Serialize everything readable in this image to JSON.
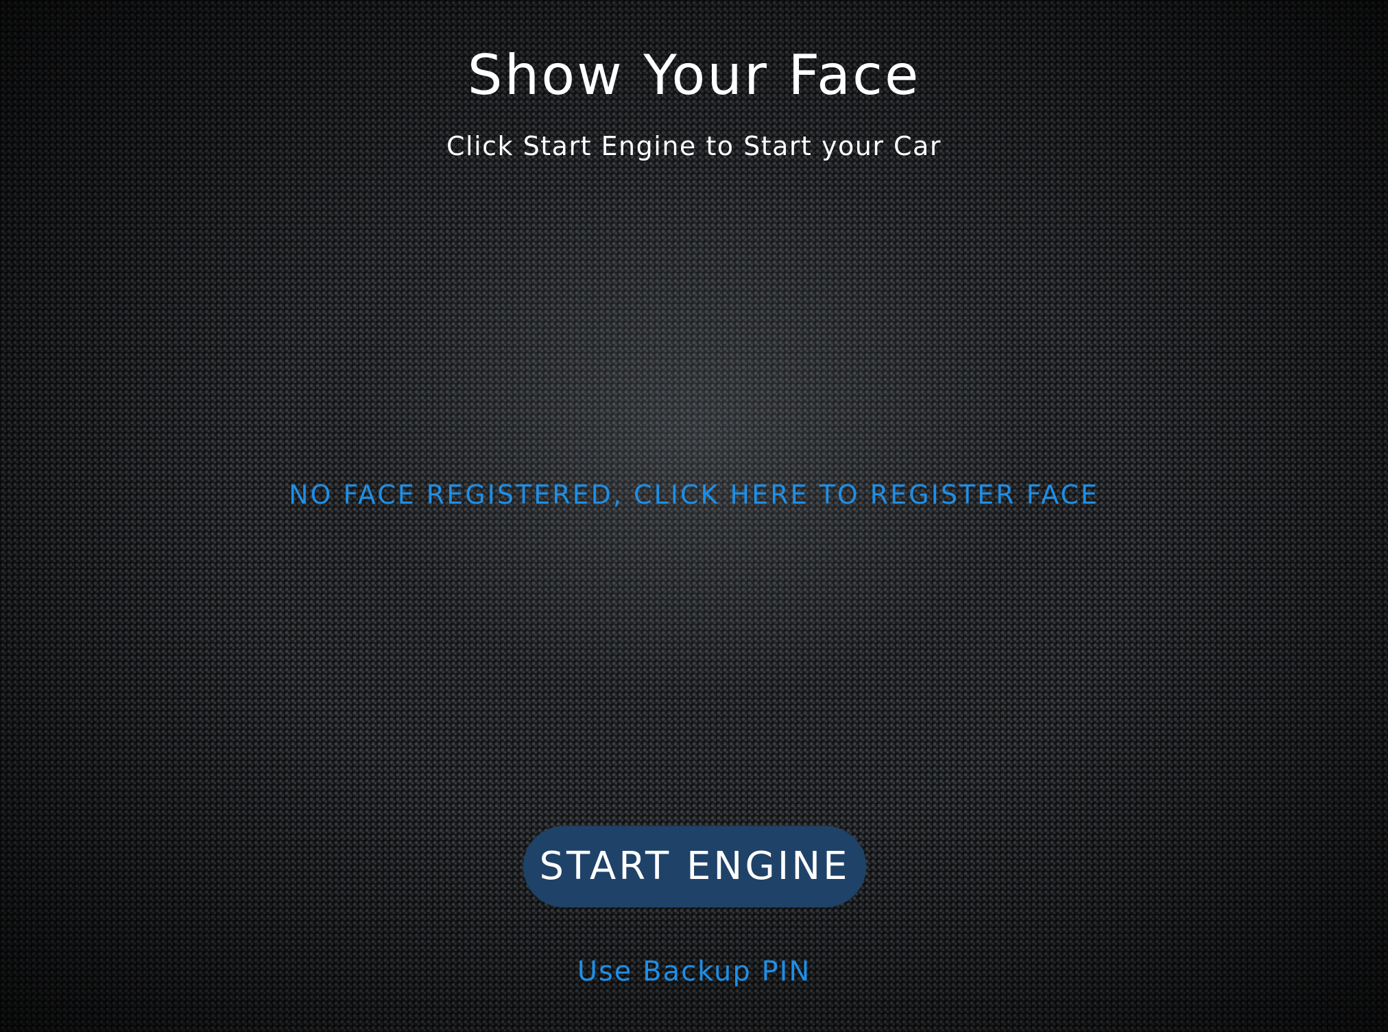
{
  "header": {
    "title": "Show Your Face",
    "subtitle": "Click Start Engine to Start your Car"
  },
  "main": {
    "register_link": "NO FACE REGISTERED, CLICK HERE TO REGISTER FACE",
    "start_button": "START ENGINE",
    "backup_pin_link": "Use Backup PIN"
  },
  "colors": {
    "background": "#1a1b1d",
    "accent_link": "#1f8fe6",
    "button_fill": "#1f4268",
    "text": "#ffffff"
  }
}
